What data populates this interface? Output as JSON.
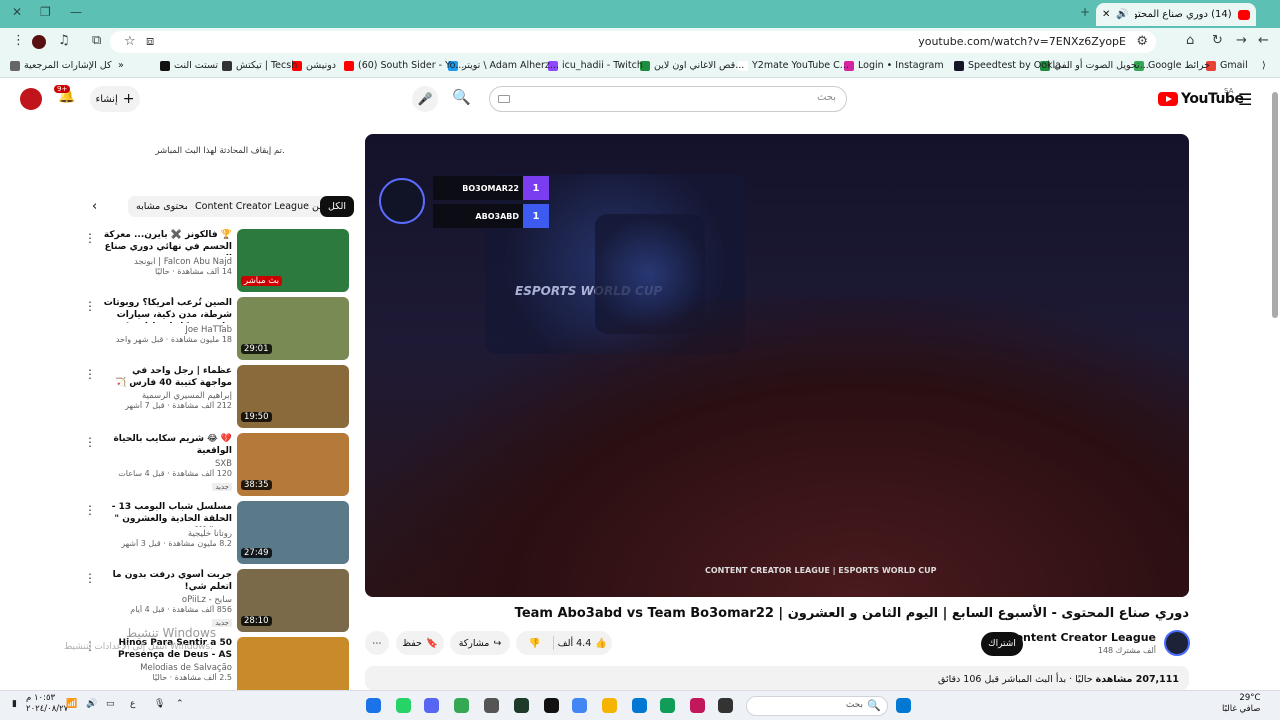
{
  "browser": {
    "tab_title": "(14) دوري صناع المحتوى - الأ...",
    "url": "youtube.com/watch?v=7ENXz6ZyopE",
    "bookmarks": [
      {
        "label": "Gmail",
        "color": "#ea4335"
      },
      {
        "label": "Google خرائط",
        "color": "#34a853"
      },
      {
        "label": "تحويل الصوت أو الفي...",
        "color": "#1e8e3e"
      },
      {
        "label": "Speedtest by Ookla...",
        "color": "#141526"
      },
      {
        "label": "Login • Instagram",
        "color": "#d6249f"
      },
      {
        "label": "Y2mate YouTube C...",
        "color": "#ffffff"
      },
      {
        "label": "قص الاغاني اون لاين...",
        "color": "#1e8e3e"
      },
      {
        "label": "icu_hadii - Twitch",
        "color": "#9146ff"
      },
      {
        "label": "تويتر \\ Adam Alherz...",
        "color": "#1d9bf0"
      },
      {
        "label": "(60) South Sider - Yo...",
        "color": "#ff0000"
      },
      {
        "label": "دونيشن",
        "color": "#ff0000"
      },
      {
        "label": "تيكتش | Tecsh",
        "color": "#333333"
      },
      {
        "label": "تستت النت",
        "color": "#111111"
      },
      {
        "label": "كل الإشارات المرجعية",
        "color": "#666666"
      }
    ]
  },
  "masthead": {
    "logo_text": "YouTube",
    "logo_region": "SA",
    "search_placeholder": "بحث",
    "create_label": "إنشاء",
    "notification_count": "9+"
  },
  "chat": {
    "closed_message": "تم إيقاف المحادثة لهذا البث المباشر."
  },
  "chips": {
    "all": "الكل",
    "from_channel": "Content Creator League من",
    "related": "محتوى مشابه"
  },
  "recommendations": [
    {
      "title": "🏆 فالكونز ✖️ بايرن... معركة الحسم في نهائي دوري صناع المحتوى...",
      "channel": "Falcon Abu Najd | ابونجد",
      "meta": "14 ألف مشاهدة · حاليًا",
      "duration": "بث مباشر",
      "new": "",
      "thumb": "#2c7a3d"
    },
    {
      "title": "الصين تُرعب أمريكا؟ روبوتات شرطة، مدن ذكية، سيارات خارقة، وذكاء اصطناعي! بين",
      "channel": "Joe HaTTab",
      "meta": "18 مليون مشاهدة · قبل شهر واحد",
      "duration": "29:01",
      "new": "",
      "thumb": "#7a8a55"
    },
    {
      "title": "عظماء | رجل واحد في مواجهة كتيبة 40 فارس 🏹",
      "channel": "إبراهيم المسيري الرسمية",
      "meta": "212 ألف مشاهدة · قبل 7 أشهر",
      "duration": "19:50",
      "new": "",
      "thumb": "#8a6a3a"
    },
    {
      "title": "💔 😂 شريم سكايب بالحياة الواقعية",
      "channel": "SXB",
      "meta": "120 ألف مشاهدة · قبل 4 ساعات",
      "duration": "38:35",
      "new": "جديد",
      "thumb": "#b57a3a"
    },
    {
      "title": "مسلسل شباب البومب 13 - الحلقة الحادية والعشرون \" فيو \" 4K",
      "channel": "روتانا خليجية",
      "meta": "8.2 مليون مشاهدة · قبل 3 أشهر",
      "duration": "27:49",
      "new": "",
      "thumb": "#5a7a8a"
    },
    {
      "title": "جربت أسوي درفت بدون ما اتعلم شي!",
      "channel": "سايح - oPiiLz",
      "meta": "856 ألف مشاهدة · قبل 4 أيام",
      "duration": "28:10",
      "new": "جديد",
      "thumb": "#7a6a4a"
    },
    {
      "title": "50 Hinos Para Sentir a Presença de Deus - AS",
      "channel": "Melodias de Salvação",
      "meta": "2.5 ألف مشاهدة · حاليًا",
      "duration": "",
      "new": "",
      "thumb": "#c98a2a"
    }
  ],
  "player": {
    "team_top": "BO3OMAR22",
    "team_bottom": "ABO3ABD",
    "score_top": "1",
    "score_bottom": "1",
    "screen_label": "ESPORTS WORLD CUP",
    "watermark": "CONTENT CREATOR LEAGUE | ESPORTS WORLD CUP"
  },
  "video": {
    "title": "دوري صناع المحتوى - الأسبوع السابع | اليوم الثامن و العشرون | Team Abo3abd vs Team Bo3omar22",
    "channel_name": "Content Creator League",
    "subscribers": "148 ألف مشترك",
    "subscribe_label": "اشتراك",
    "likes": "4.4 ألف",
    "share_label": "مشاركة",
    "save_label": "حفظ",
    "description_views": "207,111 مشاهدة",
    "description_text": "حاليًا · بدأ البث المباشر قبل 106 دقائق"
  },
  "watermark": {
    "line1": "تنشيط Windows",
    "line2": "انتقل إلى الإعدادات لتنشيط Windows."
  },
  "taskbar": {
    "search_label": "بحث",
    "temperature": "29°C",
    "weather_desc": "صافي غالبًا",
    "time": "١٠:٥٣ م",
    "date": "٢٠٢٤/٠٨/٢٧",
    "lang": "ع"
  },
  "colors": {
    "tab_bar": "#5cc0b5",
    "toolbar": "#eaf7f5",
    "youtube_red": "#ff0000"
  }
}
